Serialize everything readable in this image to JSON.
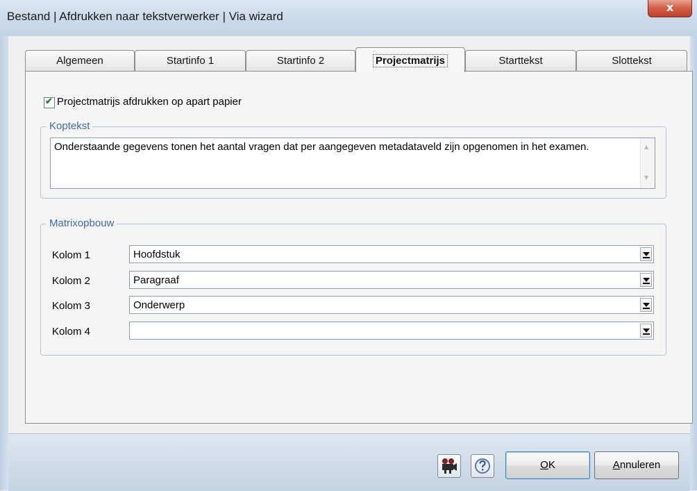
{
  "window": {
    "title": "Bestand | Afdrukken naar tekstverwerker | Via wizard",
    "close_glyph": "x"
  },
  "tabs": [
    {
      "label": "Algemeen",
      "active": false
    },
    {
      "label": "Startinfo 1",
      "active": false
    },
    {
      "label": "Startinfo 2",
      "active": false
    },
    {
      "label": "Projectmatrijs",
      "active": true
    },
    {
      "label": "Starttekst",
      "active": false
    },
    {
      "label": "Slottekst",
      "active": false
    }
  ],
  "print_separate": {
    "label": "Projectmatrijs afdrukken op apart papier",
    "checked": true
  },
  "koptekst": {
    "legend": "Koptekst",
    "text": "Onderstaande gegevens tonen het aantal vragen dat per aangegeven metadataveld zijn opgenomen in het examen."
  },
  "matrix": {
    "legend": "Matrixopbouw",
    "rows": [
      {
        "label": "Kolom 1",
        "value": "Hoofdstuk"
      },
      {
        "label": "Kolom 2",
        "value": "Paragraaf"
      },
      {
        "label": "Kolom 3",
        "value": "Onderwerp"
      },
      {
        "label": "Kolom 4",
        "value": ""
      }
    ]
  },
  "buttons": {
    "ok_mnemonic": "O",
    "ok_rest": "K",
    "cancel_mnemonic": "A",
    "cancel_rest": "nnuleren"
  },
  "icons": {
    "tool_icon": "film-projector-icon",
    "help_icon": "help-icon"
  }
}
